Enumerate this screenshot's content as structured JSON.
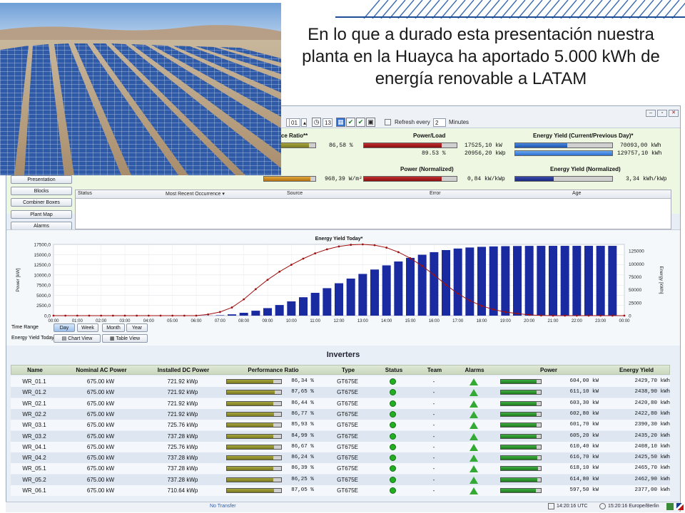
{
  "slide": {
    "headline": "En lo que a durado esta presentación nuestra planta en la Huayca ha aportado 5.000 kWh de energía renovable a LATAM"
  },
  "colors": {
    "accent_blue": "#1f4e99",
    "bar_green": "#2e9e2e",
    "bar_olive": "#8c8b2a",
    "bar_red": "#a01818",
    "bar_blue": "#2d6fd1",
    "bar_orange": "#d38b12",
    "chart_bar": "#1a2aa0",
    "chart_line": "#a01010"
  },
  "toolbar": {
    "date1": "01",
    "date2": "13",
    "refresh_label": "Refresh every",
    "refresh_value": "2",
    "refresh_unit": "Minutes"
  },
  "kpi": {
    "perf_ratio": {
      "title": "nce Ratio**",
      "value": "86,58 %",
      "fill": 0.87
    },
    "power_load": {
      "title": "Power/Load",
      "value1": "17525,10  kW",
      "value2": "20956,20 kWp",
      "pct": "89.53 %",
      "fill": 0.84
    },
    "yield_current": {
      "title": "Energy Yield (Current/Previous Day)*",
      "value1": "70093,00 kWh",
      "value2": "129757,10 kWh",
      "fill1": 0.54,
      "fill2": 1.0
    },
    "irradiation": {
      "title": "ation",
      "value": "968,39 W/m²",
      "fill": 0.9
    },
    "power_norm": {
      "title": "Power (Normalized)",
      "value": "0,84 kW/kWp",
      "fill": 0.84
    },
    "yield_norm": {
      "title": "Energy Yield (Normalized)",
      "value": "3,34 kWh/kWp",
      "fill": 0.4
    }
  },
  "nav": {
    "items": [
      "Presentation",
      "Blocks",
      "Combiner Boxes",
      "Plant Map",
      "Alarms"
    ]
  },
  "alarms": {
    "columns": [
      "Status",
      "Most Recent Occurrence ▾",
      "Source",
      "Error",
      "Age"
    ]
  },
  "controls": {
    "time_range_label": "Time Range",
    "yield_today_label": "Energy Yield Today",
    "ranges": [
      "Day",
      "Week",
      "Month",
      "Year"
    ],
    "chart_view": "Chart View",
    "table_view": "Table View"
  },
  "chart_data": {
    "type": "bar",
    "title": "Energy Yield Today*",
    "ylabel": "Power [kW]",
    "y2label": "Energy [kWh]",
    "ylim": [
      0,
      17500
    ],
    "y2lim": [
      0,
      137500
    ],
    "yticks": [
      "17500,0",
      "15000,0",
      "12500,0",
      "10000,0",
      "7500,0",
      "5000,0",
      "2500,0",
      "0,0"
    ],
    "y2ticks": [
      "125000",
      "100000",
      "75000",
      "50000",
      "25000",
      "0"
    ],
    "xticks": [
      "00:00",
      "01:00",
      "02:00",
      "03:00",
      "04:00",
      "05:00",
      "06:00",
      "07:00",
      "08:00",
      "09:00",
      "10:00",
      "11:00",
      "12:00",
      "13:00",
      "14:00",
      "15:00",
      "16:00",
      "17:00",
      "18:00",
      "19:00",
      "20:00",
      "21:00",
      "22:00",
      "23:00",
      "00:00"
    ],
    "series": [
      {
        "type": "line",
        "x_hours": [
          0,
          6,
          6.5,
          7,
          7.5,
          8,
          8.5,
          9,
          9.5,
          10,
          10.5,
          11,
          11.5,
          12,
          12.5,
          13,
          13.5,
          14,
          14.5,
          15,
          15.5,
          16,
          16.5,
          17,
          17.5,
          18,
          18.5,
          19,
          19.5,
          20,
          20.5,
          21,
          24
        ],
        "values": [
          0,
          0,
          300,
          900,
          2000,
          4000,
          6500,
          8800,
          10800,
          12500,
          14000,
          15300,
          16300,
          17000,
          17400,
          17500,
          17300,
          16700,
          15600,
          14100,
          12200,
          10000,
          7600,
          5400,
          3700,
          2400,
          1500,
          900,
          500,
          200,
          50,
          0,
          0
        ]
      },
      {
        "type": "bar",
        "x_hours": [
          6.5,
          7,
          7.5,
          8,
          8.5,
          9,
          9.5,
          10,
          10.5,
          11,
          11.5,
          12,
          12.5,
          13,
          13.5,
          14,
          14.5,
          15,
          15.5,
          16,
          16.5,
          17,
          17.5,
          18,
          18.5,
          19,
          19.5,
          20,
          20.5,
          21,
          21.5,
          22,
          22.5,
          23,
          23.5
        ],
        "values": [
          200,
          800,
          2500,
          5500,
          9500,
          14500,
          20500,
          27500,
          35500,
          44000,
          53000,
          62500,
          71500,
          80500,
          89000,
          97000,
          104500,
          111500,
          117500,
          122500,
          126500,
          129500,
          131500,
          132800,
          133600,
          134100,
          134400,
          134600,
          134700,
          134700,
          134700,
          134700,
          134700,
          134700,
          134700
        ]
      }
    ]
  },
  "inverters": {
    "title": "Inverters",
    "columns": [
      "Name",
      "Nominal AC Power",
      "Installed DC Power",
      "Performance Ratio",
      "Type",
      "Status",
      "Team",
      "Alarms",
      "Power",
      "Energy Yield"
    ],
    "rows": [
      {
        "name": "WR_01.1",
        "ac": "675.00 kW",
        "dc": "721.92 kWp",
        "pr": "86,34 %",
        "type": "GT675E",
        "team": "-",
        "power": "604,00  kW",
        "yield": "2429,70 kWh",
        "pr_fill": 0.86,
        "pw_fill": 0.89
      },
      {
        "name": "WR_01.2",
        "ac": "675.00 kW",
        "dc": "721.92 kWp",
        "pr": "87,65 %",
        "type": "GT675E",
        "team": "-",
        "power": "611,10  kW",
        "yield": "2438,90 kWh",
        "pr_fill": 0.88,
        "pw_fill": 0.9
      },
      {
        "name": "WR_02.1",
        "ac": "675.00 kW",
        "dc": "721.92 kWp",
        "pr": "86,44 %",
        "type": "GT675E",
        "team": "-",
        "power": "603,30  kW",
        "yield": "2420,80 kWh",
        "pr_fill": 0.86,
        "pw_fill": 0.89
      },
      {
        "name": "WR_02.2",
        "ac": "675.00 kW",
        "dc": "721.92 kWp",
        "pr": "86,77 %",
        "type": "GT675E",
        "team": "-",
        "power": "602,80  kW",
        "yield": "2422,80 kWh",
        "pr_fill": 0.87,
        "pw_fill": 0.89
      },
      {
        "name": "WR_03.1",
        "ac": "675.00 kW",
        "dc": "725.76 kWp",
        "pr": "85,93 %",
        "type": "GT675E",
        "team": "-",
        "power": "601,70  kW",
        "yield": "2390,30 kWh",
        "pr_fill": 0.86,
        "pw_fill": 0.89
      },
      {
        "name": "WR_03.2",
        "ac": "675.00 kW",
        "dc": "737.28 kWp",
        "pr": "84,99 %",
        "type": "GT675E",
        "team": "-",
        "power": "605,20  kW",
        "yield": "2435,20 kWh",
        "pr_fill": 0.85,
        "pw_fill": 0.9
      },
      {
        "name": "WR_04.1",
        "ac": "675.00 kW",
        "dc": "725.76 kWp",
        "pr": "86,67 %",
        "type": "GT675E",
        "team": "-",
        "power": "610,40  kW",
        "yield": "2408,10 kWh",
        "pr_fill": 0.87,
        "pw_fill": 0.9
      },
      {
        "name": "WR_04.2",
        "ac": "675.00 kW",
        "dc": "737.28 kWp",
        "pr": "86,24 %",
        "type": "GT675E",
        "team": "-",
        "power": "616,70  kW",
        "yield": "2425,50 kWh",
        "pr_fill": 0.86,
        "pw_fill": 0.91
      },
      {
        "name": "WR_05.1",
        "ac": "675.00 kW",
        "dc": "737.28 kWp",
        "pr": "86,39 %",
        "type": "GT675E",
        "team": "-",
        "power": "618,10  kW",
        "yield": "2465,70 kWh",
        "pr_fill": 0.86,
        "pw_fill": 0.92
      },
      {
        "name": "WR_05.2",
        "ac": "675.00 kW",
        "dc": "737.28 kWp",
        "pr": "86,25 %",
        "type": "GT675E",
        "team": "-",
        "power": "614,80  kW",
        "yield": "2462,90 kWh",
        "pr_fill": 0.86,
        "pw_fill": 0.91
      },
      {
        "name": "WR_06.1",
        "ac": "675.00 kW",
        "dc": "710.64 kWp",
        "pr": "87,05 %",
        "type": "GT675E",
        "team": "-",
        "power": "597,50  kW",
        "yield": "2377,00 kWh",
        "pr_fill": 0.87,
        "pw_fill": 0.88
      }
    ]
  },
  "statusbar": {
    "left": "No Transfer",
    "utc": "14:20:16 UTC",
    "local": "15:20:16 Europe/Berlin"
  }
}
